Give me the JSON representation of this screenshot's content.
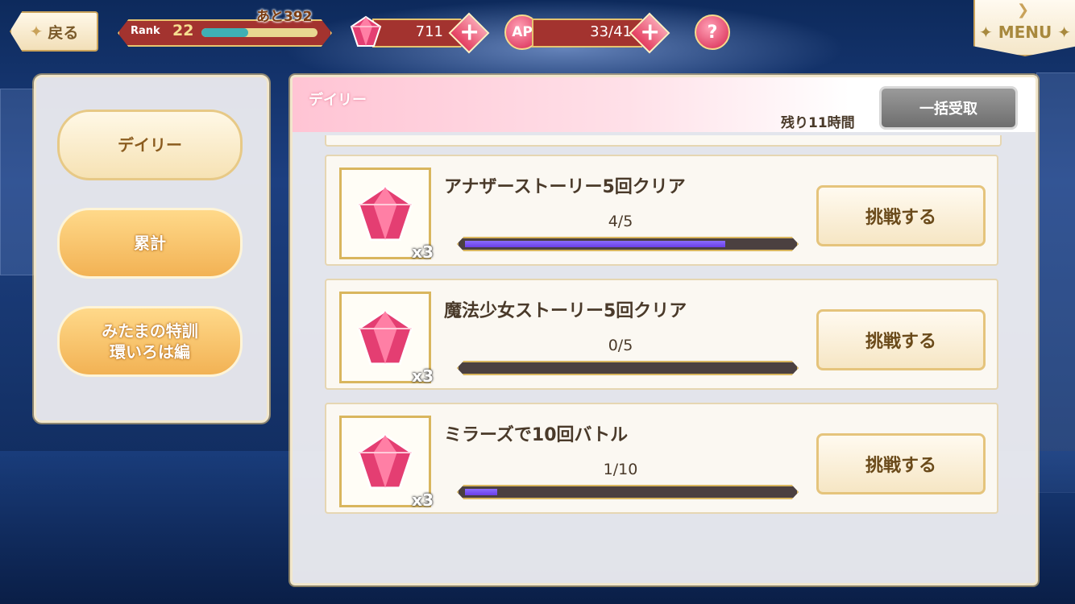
{
  "header": {
    "back_label": "戻る",
    "rank_label": "Rank",
    "rank_value": "22",
    "rank_next": "あと392",
    "rank_progress": 0.4,
    "stones_value": "711",
    "ap_label": "AP",
    "ap_value": "33/41",
    "help_label": "?",
    "plus_label": "+",
    "menu_label": "MENU"
  },
  "sidebar": {
    "items": [
      {
        "label": "デイリー",
        "active": true
      },
      {
        "label": "累計",
        "active": false
      },
      {
        "label": "みたまの特訓\n環いろは編",
        "active": false
      }
    ]
  },
  "main": {
    "title": "デイリー",
    "remaining": "残り11時間",
    "claim_all_label": "一括受取",
    "missions": [
      {
        "title": "アナザーストーリー5回クリア",
        "progress_text": "4/5",
        "progress": 0.8,
        "reward_qty": "x3",
        "button": "挑戦する"
      },
      {
        "title": "魔法少女ストーリー5回クリア",
        "progress_text": "0/5",
        "progress": 0.0,
        "reward_qty": "x3",
        "button": "挑戦する"
      },
      {
        "title": "ミラーズで10回バトル",
        "progress_text": "1/10",
        "progress": 0.1,
        "reward_qty": "x3",
        "button": "挑戦する"
      }
    ]
  },
  "colors": {
    "accent": "#a3332f",
    "gold": "#e6c46f",
    "gem": "#e43e72",
    "progress": "#6b3fe8"
  },
  "icons": {
    "back": "sparkle-icon",
    "stones": "magic-stone-icon",
    "reward": "gem-icon",
    "menu": "chevron-down-icon"
  }
}
